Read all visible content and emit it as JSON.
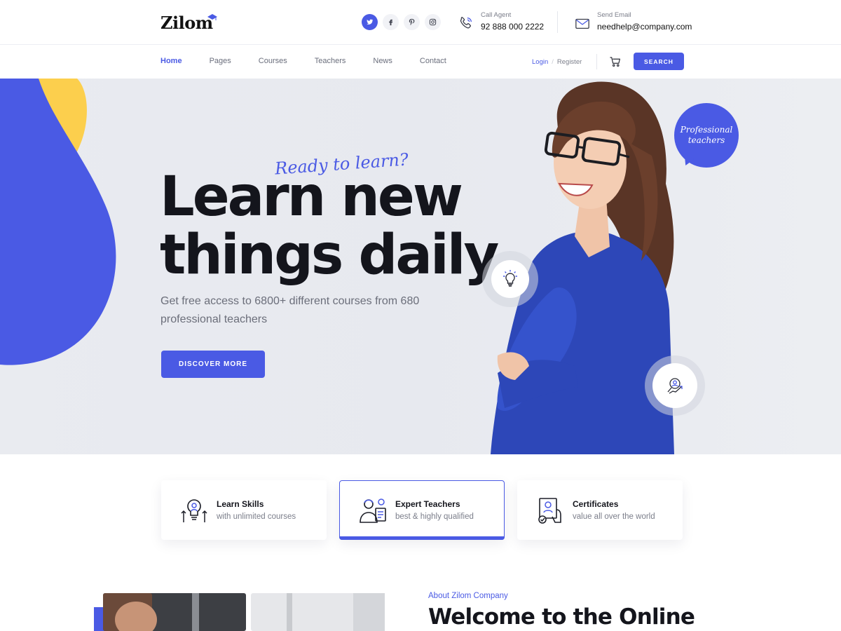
{
  "brand": {
    "name": "Zilom"
  },
  "topbar": {
    "socials": [
      {
        "icon": "twitter-icon"
      },
      {
        "icon": "facebook-icon"
      },
      {
        "icon": "pinterest-icon"
      },
      {
        "icon": "instagram-icon"
      }
    ],
    "call": {
      "label": "Call Agent",
      "value": "92 888 000 2222"
    },
    "email": {
      "label": "Send Email",
      "value": "needhelp@company.com"
    }
  },
  "nav": {
    "links": [
      "Home",
      "Pages",
      "Courses",
      "Teachers",
      "News",
      "Contact"
    ],
    "active": "Home",
    "login": "Login",
    "register": "Register",
    "search_label": "SEARCH"
  },
  "hero": {
    "tagline": "Ready to learn?",
    "title_line1": "Learn new",
    "title_line2": "things daily",
    "subtitle": "Get free access to 6800+ different courses from 680 professional teachers",
    "button_label": "DISCOVER MORE",
    "badge_line1": "Professional",
    "badge_line2": "teachers"
  },
  "features": [
    {
      "title": "Learn Skills",
      "desc": "with unlimited courses",
      "icon": "bulb-growth-icon"
    },
    {
      "title": "Expert Teachers",
      "desc": "best & highly qualified",
      "icon": "teacher-icon"
    },
    {
      "title": "Certificates",
      "desc": "value all over the world",
      "icon": "certificate-icon"
    }
  ],
  "about": {
    "kicker": "About Zilom Company",
    "title": "Welcome to the Online"
  },
  "colors": {
    "accent": "#4a5ae4",
    "yellow": "#fccf4d",
    "dark": "#14151c"
  }
}
